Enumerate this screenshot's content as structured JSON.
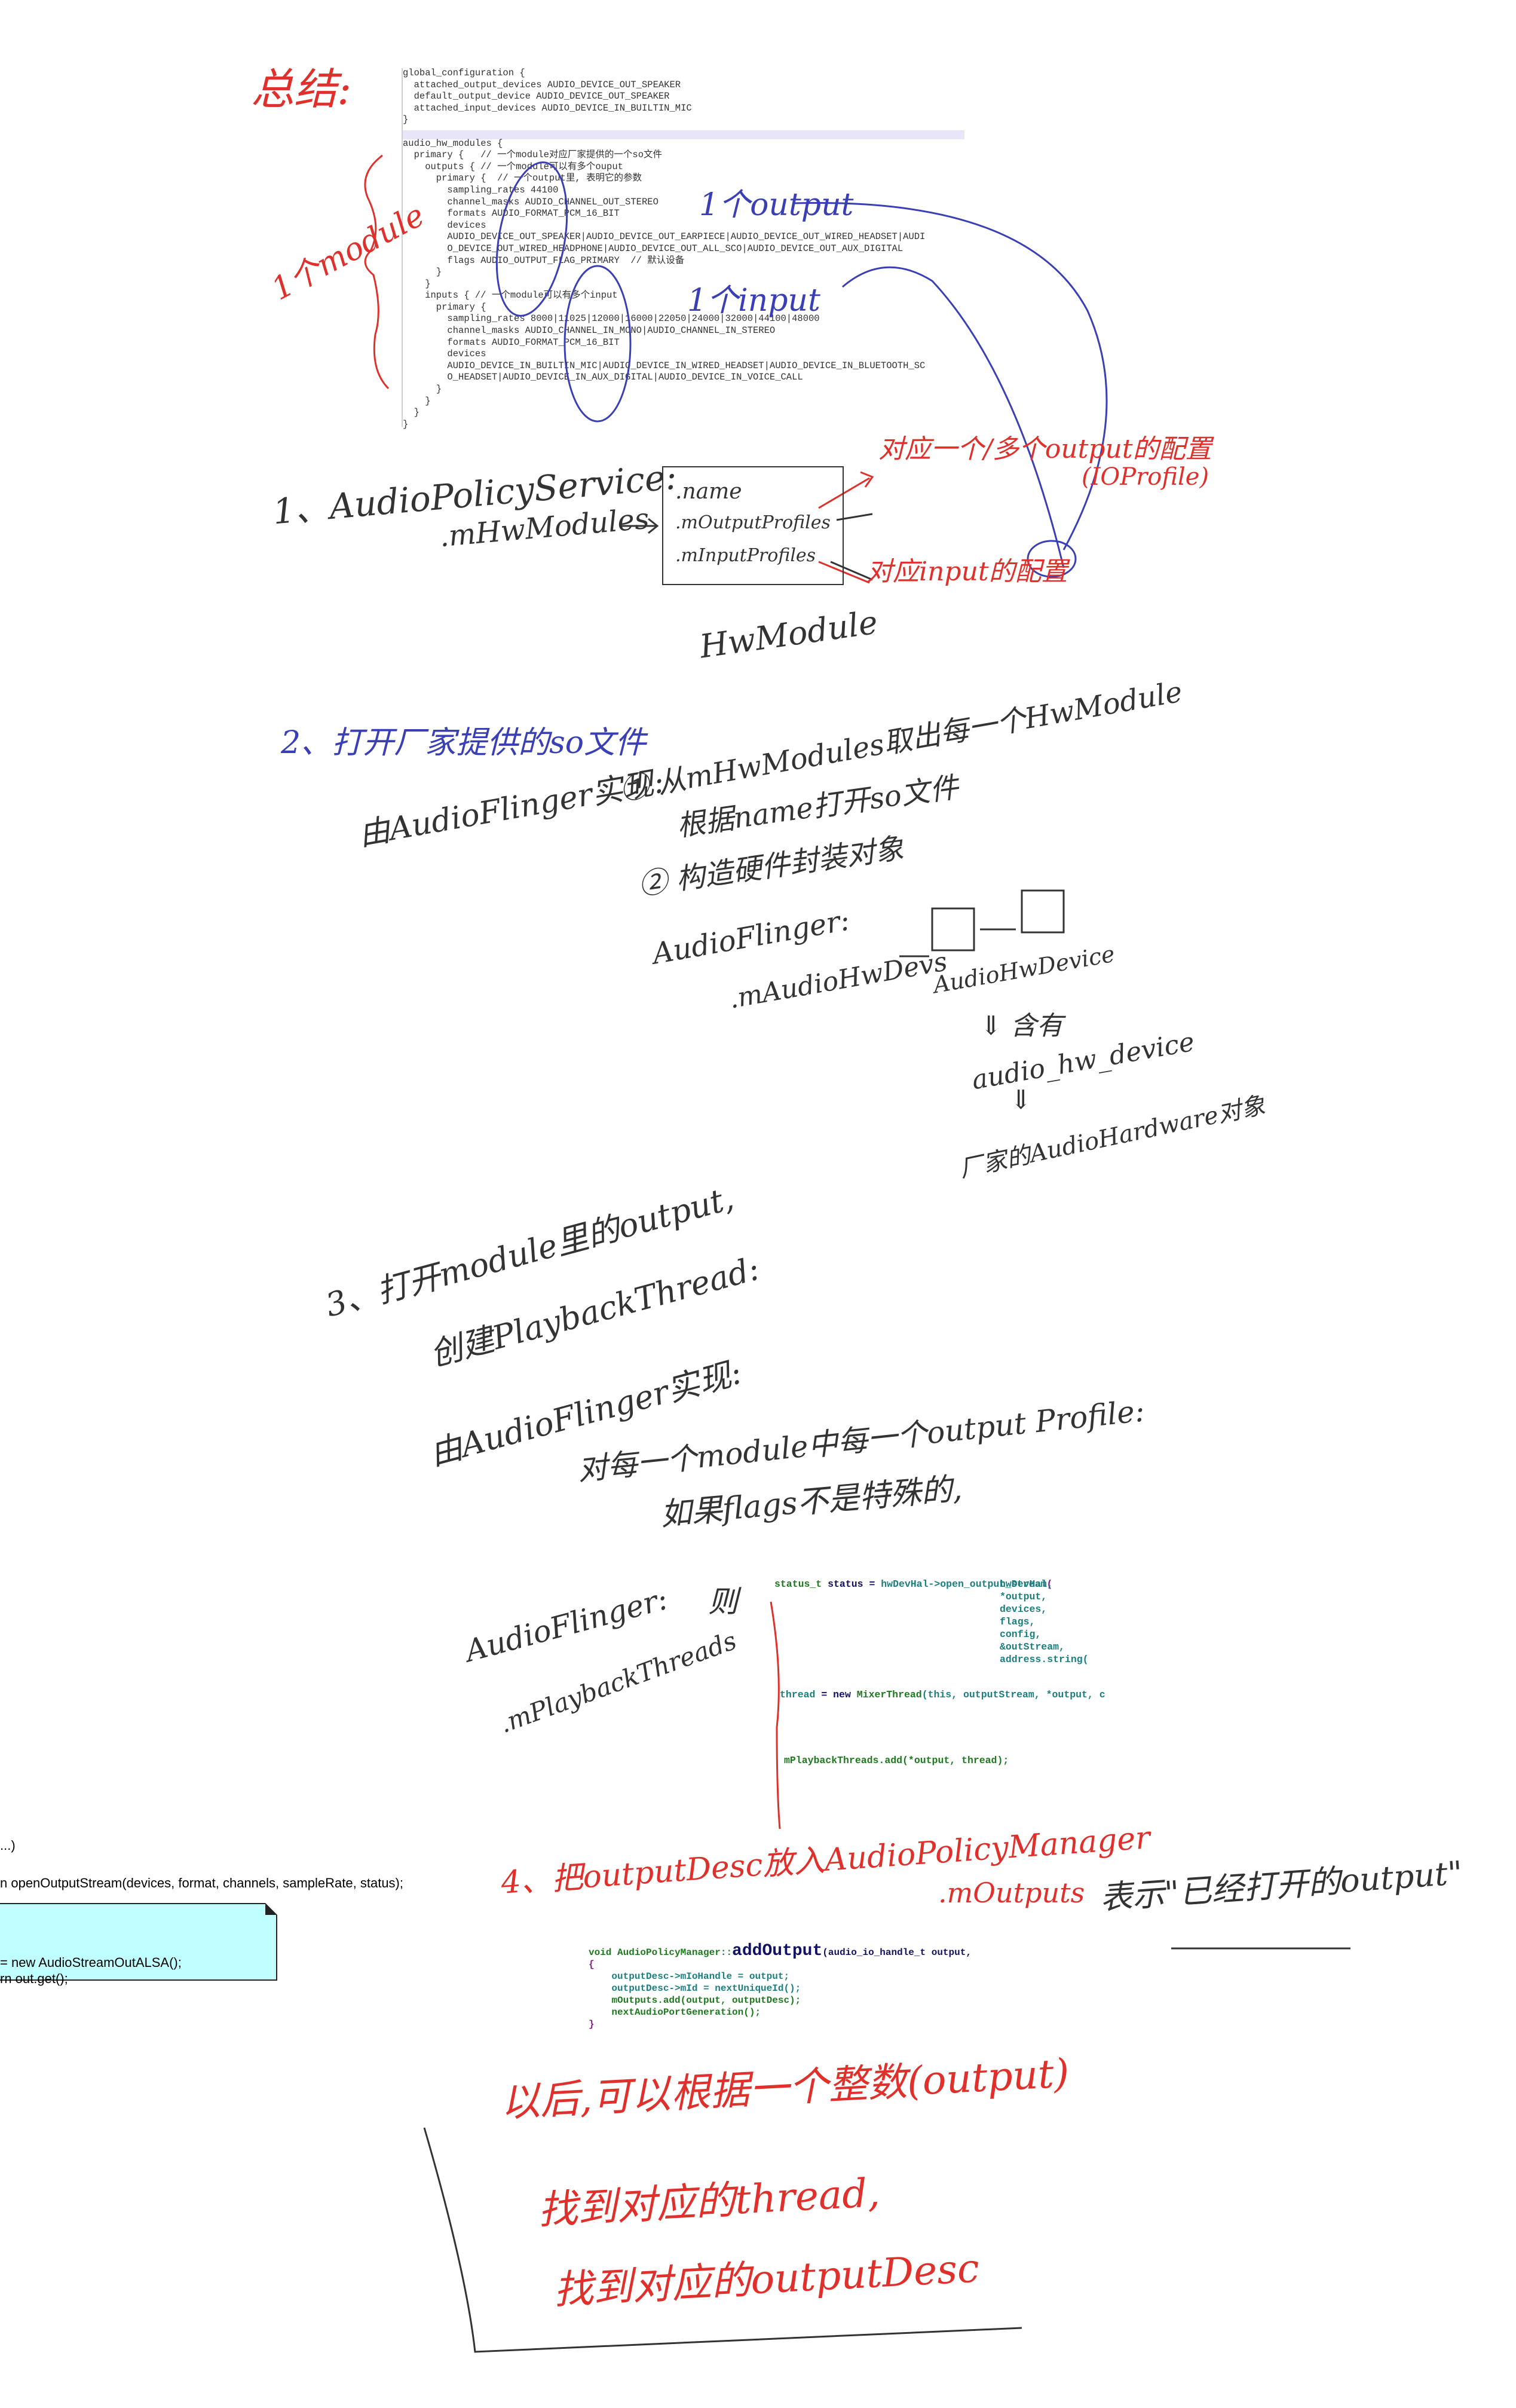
{
  "summary_title": "总结:",
  "module_label": "1个module",
  "config": {
    "lines": [
      "global_configuration {",
      "  attached_output_devices AUDIO_DEVICE_OUT_SPEAKER",
      "  default_output_device AUDIO_DEVICE_OUT_SPEAKER",
      "  attached_input_devices AUDIO_DEVICE_IN_BUILTIN_MIC",
      "}",
      "",
      "audio_hw_modules {",
      "  primary {   // 一个module对应厂家提供的一个so文件",
      "    outputs { // 一个module可以有多个ouput",
      "      primary {  // 一个output里, 表明它的参数",
      "        sampling_rates 44100",
      "        channel_masks AUDIO_CHANNEL_OUT_STEREO",
      "        formats AUDIO_FORMAT_PCM_16_BIT",
      "        devices",
      "        AUDIO_DEVICE_OUT_SPEAKER|AUDIO_DEVICE_OUT_EARPIECE|AUDIO_DEVICE_OUT_WIRED_HEADSET|AUDI",
      "        O_DEVICE_OUT_WIRED_HEADPHONE|AUDIO_DEVICE_OUT_ALL_SCO|AUDIO_DEVICE_OUT_AUX_DIGITAL",
      "        flags AUDIO_OUTPUT_FLAG_PRIMARY  // 默认设备",
      "      }",
      "    }",
      "    inputs { // 一个module可以有多个input",
      "      primary {",
      "        sampling_rates 8000|11025|12000|16000|22050|24000|32000|44100|48000",
      "        channel_masks AUDIO_CHANNEL_IN_MONO|AUDIO_CHANNEL_IN_STEREO",
      "        formats AUDIO_FORMAT_PCM_16_BIT",
      "        devices",
      "        AUDIO_DEVICE_IN_BUILTIN_MIC|AUDIO_DEVICE_IN_WIRED_HEADSET|AUDIO_DEVICE_IN_BLUETOOTH_SC",
      "        O_HEADSET|AUDIO_DEVICE_IN_AUX_DIGITAL|AUDIO_DEVICE_IN_VOICE_CALL",
      "      }",
      "    }",
      "  }",
      "}"
    ],
    "output_annotation": "1个output",
    "input_annotation": "1个input"
  },
  "section1": {
    "title": "1、AudioPolicyService:",
    "member": ".mHwModules",
    "box_fields": [
      ".name",
      ".mOutputProfiles",
      ".mInputProfiles"
    ],
    "box_label": "HwModule",
    "output_note": "对应一个/多个output的配置",
    "output_note2": "(IOProfile)",
    "input_note": "对应input的配置"
  },
  "section2": {
    "title": "2、打开厂家提供的so文件",
    "impl": "由AudioFlinger实现:",
    "step1": "① 从mHwModules取出每一个HwModule",
    "step1b": "根据name打开so文件",
    "step2": "② 构造硬件封装对象",
    "af": "AudioFlinger:",
    "member": ".mAudioHwDevs",
    "device": "AudioHwDevice",
    "contains": "⇓ 含有",
    "hw_device": "audio_hw_device",
    "down": "⇓",
    "vendor": "厂家的AudioHardware对象"
  },
  "section3": {
    "title": "3、打开module里的output,",
    "line2": "创建PlaybackThread:",
    "impl": "由AudioFlinger实现:",
    "loop": "对每一个module中每一个output Profile:",
    "cond": "如果flags不是特殊的,",
    "then": "则",
    "af": "AudioFlinger:",
    "member": ".mPlaybackThreads",
    "code": {
      "status_type": "status_t",
      "status_var": "status",
      "call": "hwDevHal->open_output_stream",
      "args": [
        "hwDevHal,",
        "*output,",
        "devices,",
        "flags,",
        "config,",
        "&outStream,",
        "address.string("
      ],
      "thread_line": "thread",
      "new_kw": "new",
      "mixer": "MixerThread",
      "mixer_args": "(this, outputStream, *output, c",
      "add_line": "mPlaybackThreads.add(*output, thread);"
    }
  },
  "left_fragment": {
    "line1": "...)",
    "line2": "n openOutputStream(devices, format, channels, sampleRate, status);",
    "note_line1": "= new AudioStreamOutALSA();",
    "note_line2": "rn out.get();"
  },
  "section4": {
    "title": "4、把outputDesc放入AudioPolicyManager",
    "member": ".mOutputs",
    "meaning": "表示\"已经打开的output\"",
    "code": {
      "sig_void": "void",
      "sig_class": "AudioPolicyManager::",
      "sig_fn": "addOutput",
      "sig_args": "(audio_io_handle_t output,",
      "open": "{",
      "l1": "outputDesc->mIoHandle = output;",
      "l2": "outputDesc->mId = nextUniqueId();",
      "l3": "mOutputs.add(output, outputDesc);",
      "l4": "nextAudioPortGeneration();",
      "close": "}"
    }
  },
  "conclusion": {
    "line1": "以后,可以根据一个整数(output)",
    "line2": "找到对应的thread,",
    "line3": "找到对应的outputDesc"
  },
  "colors": {
    "red_ink": "#e0302c",
    "blue_ink": "#3a3fb5",
    "note_bg": "#c0ffff"
  }
}
